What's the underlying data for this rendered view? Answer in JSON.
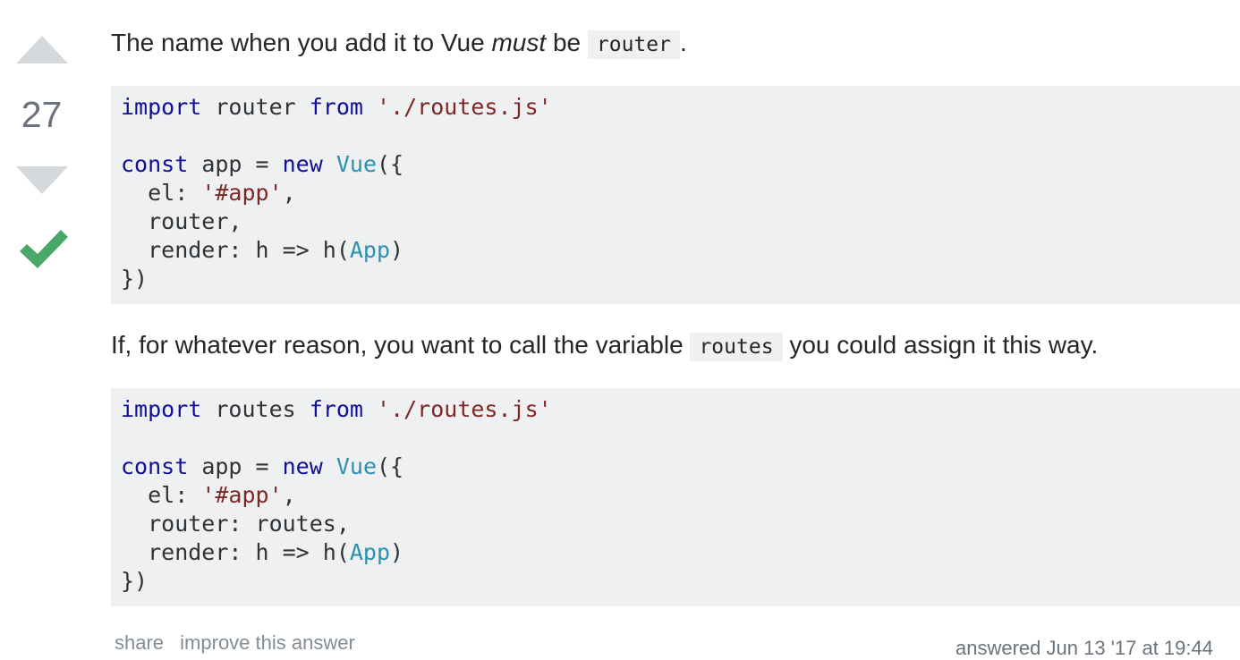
{
  "vote": {
    "up_icon": "vote-up-arrow-icon",
    "count": "27",
    "down_icon": "vote-down-arrow-icon",
    "accepted_icon": "checkmark-icon",
    "accepted_color": "#48a868"
  },
  "answer": {
    "para1": {
      "before": "The name when you add it to Vue",
      "emphasis": "must",
      "after": "be",
      "code": "router",
      "end": "."
    },
    "code1": {
      "l1_kw1": "import",
      "l1_mid": " router ",
      "l1_kw2": "from",
      "l1_sp": " ",
      "l1_str": "'./routes.js'",
      "l3_kw1": "const",
      "l3_mid": " app = ",
      "l3_kw2": "new",
      "l3_sp": " ",
      "l3_typ": "Vue",
      "l3_end": "({",
      "l4_a": "  el: ",
      "l4_str": "'#app'",
      "l4_b": ",",
      "l5": "  router,",
      "l6_a": "  render: h => h(",
      "l6_typ": "App",
      "l6_b": ")",
      "l7": "})"
    },
    "para2": {
      "before": "If, for whatever reason, you want to call the variable",
      "code": "routes",
      "after": "you could assign it this way."
    },
    "code2": {
      "l1_kw1": "import",
      "l1_mid": " routes ",
      "l1_kw2": "from",
      "l1_sp": " ",
      "l1_str": "'./routes.js'",
      "l3_kw1": "const",
      "l3_mid": " app = ",
      "l3_kw2": "new",
      "l3_sp": " ",
      "l3_typ": "Vue",
      "l3_end": "({",
      "l4_a": "  el: ",
      "l4_str": "'#app'",
      "l4_b": ",",
      "l5": "  router: routes,",
      "l6_a": "  render: h => h(",
      "l6_typ": "App",
      "l6_b": ")",
      "l7": "})"
    }
  },
  "post_menu": {
    "share": "share",
    "improve": "improve this answer"
  },
  "signature": {
    "answered": "answered Jun 13 '17 at 19:44"
  }
}
